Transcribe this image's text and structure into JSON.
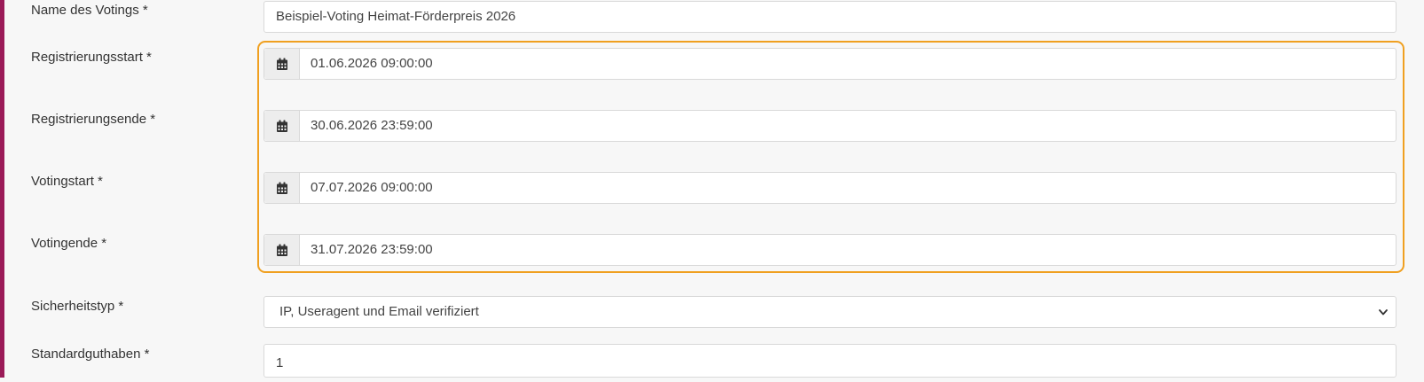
{
  "colors": {
    "accent_bar": "#9b1b58",
    "highlight_border": "#f0a020"
  },
  "form": {
    "name": {
      "label": "Name des Votings *",
      "value": "Beispiel-Voting Heimat-Förderpreis 2026"
    },
    "registration_start": {
      "label": "Registrierungsstart *",
      "value": "01.06.2026 09:00:00",
      "icon": "calendar-icon"
    },
    "registration_end": {
      "label": "Registrierungsende *",
      "value": "30.06.2026 23:59:00",
      "icon": "calendar-icon"
    },
    "voting_start": {
      "label": "Votingstart *",
      "value": "07.07.2026 09:00:00",
      "icon": "calendar-icon"
    },
    "voting_end": {
      "label": "Votingende *",
      "value": "31.07.2026 23:59:00",
      "icon": "calendar-icon"
    },
    "security_type": {
      "label": "Sicherheitstyp *",
      "value": "IP, Useragent und Email verifiziert",
      "icon": "chevron-down-icon"
    },
    "default_credit": {
      "label": "Standardguthaben *",
      "value": "1"
    }
  }
}
